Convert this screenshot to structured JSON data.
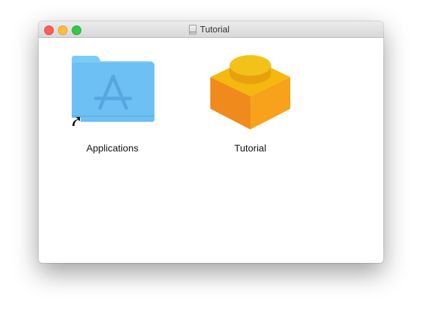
{
  "window": {
    "title": "Tutorial"
  },
  "items": [
    {
      "label": "Applications",
      "icon": "applications-folder-alias-icon"
    },
    {
      "label": "Tutorial",
      "icon": "lego-brick-app-icon"
    }
  ],
  "colors": {
    "folder": "#7ccbf7",
    "brick_top": "#f5b80e",
    "brick_left": "#f09020",
    "brick_right": "#f7a81e"
  }
}
